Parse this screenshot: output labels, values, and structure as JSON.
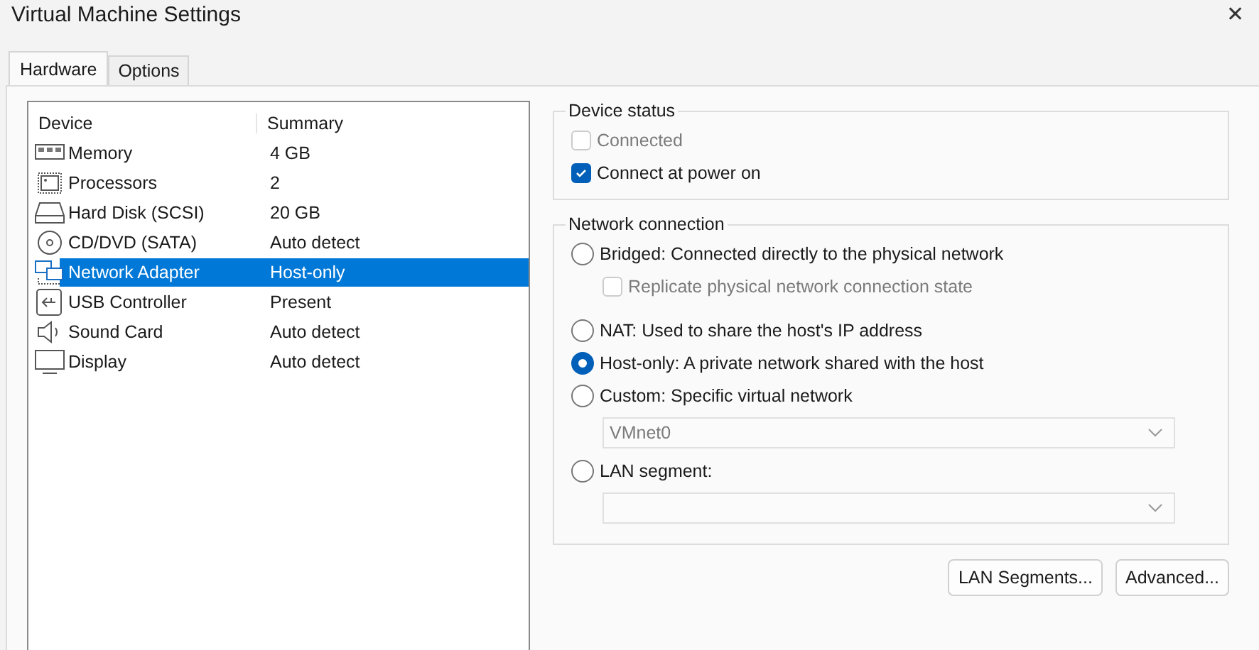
{
  "window": {
    "title": "Virtual Machine Settings",
    "close": "✕"
  },
  "tabs": [
    {
      "label": "Hardware",
      "selected": true
    },
    {
      "label": "Options",
      "selected": false
    }
  ],
  "devices": {
    "columns": [
      "Device",
      "Summary"
    ],
    "rows": [
      {
        "kind": "memory",
        "device": "Memory",
        "summary": "4 GB",
        "selected": false
      },
      {
        "kind": "processor",
        "device": "Processors",
        "summary": "2",
        "selected": false
      },
      {
        "kind": "disk",
        "device": "Hard Disk (SCSI)",
        "summary": "20 GB",
        "selected": false
      },
      {
        "kind": "cd",
        "device": "CD/DVD (SATA)",
        "summary": "Auto detect",
        "selected": false
      },
      {
        "kind": "network",
        "device": "Network Adapter",
        "summary": "Host-only",
        "selected": true
      },
      {
        "kind": "usb",
        "device": "USB Controller",
        "summary": "Present",
        "selected": false
      },
      {
        "kind": "sound",
        "device": "Sound Card",
        "summary": "Auto detect",
        "selected": false
      },
      {
        "kind": "display",
        "device": "Display",
        "summary": "Auto detect",
        "selected": false
      }
    ]
  },
  "device_status": {
    "title": "Device status",
    "options": [
      {
        "label": "Connected",
        "checked": false,
        "disabled": true
      },
      {
        "label": "Connect at power on",
        "checked": true,
        "disabled": false
      }
    ]
  },
  "network_connection": {
    "title": "Network connection",
    "options": [
      {
        "kind": "radio",
        "label": "Bridged: Connected directly to the physical network",
        "selected": false
      },
      {
        "kind": "checkbox",
        "label": "Replicate physical network connection state",
        "checked": false,
        "disabled": true
      },
      {
        "kind": "radio",
        "label": "NAT: Used to share the host's IP address",
        "selected": false
      },
      {
        "kind": "radio",
        "label": "Host-only: A private network shared with the host",
        "selected": true
      },
      {
        "kind": "radio",
        "label": "Custom: Specific virtual network",
        "selected": false
      },
      {
        "kind": "dropdown",
        "value": "VMnet0",
        "disabled": true
      },
      {
        "kind": "radio",
        "label": "LAN segment:",
        "selected": false
      },
      {
        "kind": "dropdown",
        "disabled": true
      }
    ]
  },
  "buttons": [
    "LAN Segments...",
    "Advanced..."
  ]
}
